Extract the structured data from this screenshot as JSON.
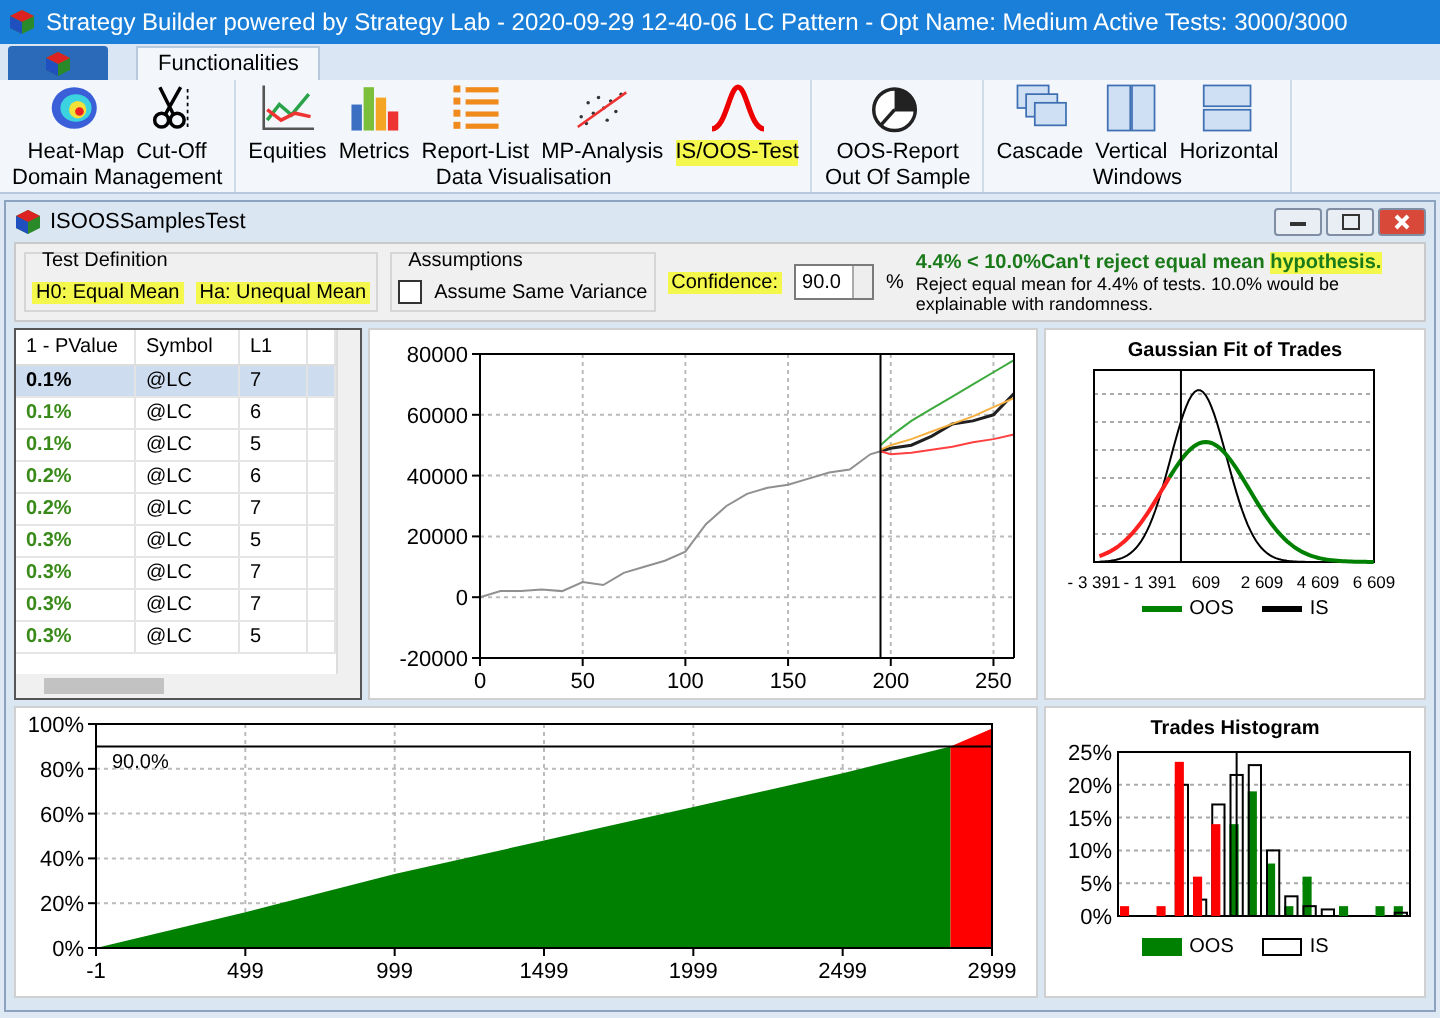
{
  "window": {
    "title": "Strategy Builder powered by Strategy Lab - 2020-09-29 12-40-06 LC Pattern - Opt Name: Medium Active Tests: 3000/3000"
  },
  "ribbon": {
    "tabs": [
      {
        "label": "Functionalities",
        "selected": true
      }
    ],
    "groups": [
      {
        "label": "Domain Management",
        "items": [
          {
            "label": "Heat-Map",
            "kind": "heatmap",
            "highlighted": false
          },
          {
            "label": "Cut-Off",
            "kind": "scissors",
            "highlighted": false
          }
        ]
      },
      {
        "label": "Data Visualisation",
        "items": [
          {
            "label": "Equities",
            "kind": "linechart",
            "highlighted": false
          },
          {
            "label": "Metrics",
            "kind": "barchart",
            "highlighted": false
          },
          {
            "label": "Report-List",
            "kind": "list",
            "highlighted": false
          },
          {
            "label": "MP-Analysis",
            "kind": "scatter",
            "highlighted": false
          },
          {
            "label": "IS/OOS-Test",
            "kind": "bell",
            "highlighted": true
          }
        ]
      },
      {
        "label": "Out Of Sample",
        "items": [
          {
            "label": "OOS-Report",
            "kind": "pie",
            "highlighted": false
          }
        ]
      },
      {
        "label": "Windows",
        "items": [
          {
            "label": "Cascade",
            "kind": "cascade",
            "highlighted": false
          },
          {
            "label": "Vertical",
            "kind": "vertical",
            "highlighted": false
          },
          {
            "label": "Horizontal",
            "kind": "horizontal",
            "highlighted": false
          }
        ]
      }
    ]
  },
  "child_window": {
    "title": "ISOOSSamplesTest"
  },
  "test_definition": {
    "title": "Test Definition",
    "h0": "H0: Equal Mean",
    "ha": "Ha: Unequal Mean",
    "highlighted": true
  },
  "assumptions": {
    "title": "Assumptions",
    "checkbox": {
      "label": "Assume Same Variance",
      "checked": false
    }
  },
  "confidence": {
    "label": "Confidence:",
    "value": "90.0",
    "unit": "%",
    "highlighted": true
  },
  "result": {
    "text": "4.4% < 10.0%Can't reject equal mean ",
    "highlight": "hypothesis.",
    "note": "Reject equal mean for 4.4% of tests. 10.0% would be explainable with randomness."
  },
  "table": {
    "columns": [
      "1 - PValue",
      "Symbol",
      "L1"
    ],
    "rows": [
      {
        "pvalue": "0.1%",
        "symbol": "@LC",
        "l1": "7",
        "selected": true
      },
      {
        "pvalue": "0.1%",
        "symbol": "@LC",
        "l1": "6",
        "selected": false
      },
      {
        "pvalue": "0.1%",
        "symbol": "@LC",
        "l1": "5",
        "selected": false
      },
      {
        "pvalue": "0.2%",
        "symbol": "@LC",
        "l1": "6",
        "selected": false
      },
      {
        "pvalue": "0.2%",
        "symbol": "@LC",
        "l1": "7",
        "selected": false
      },
      {
        "pvalue": "0.3%",
        "symbol": "@LC",
        "l1": "5",
        "selected": false
      },
      {
        "pvalue": "0.3%",
        "symbol": "@LC",
        "l1": "7",
        "selected": false
      },
      {
        "pvalue": "0.3%",
        "symbol": "@LC",
        "l1": "7",
        "selected": false
      },
      {
        "pvalue": "0.3%",
        "symbol": "@LC",
        "l1": "5",
        "selected": false
      }
    ]
  },
  "equity_chart": {
    "chart_data": {
      "type": "line",
      "x": [
        0,
        10,
        20,
        30,
        40,
        50,
        60,
        70,
        80,
        90,
        100,
        110,
        120,
        130,
        140,
        150,
        160,
        170,
        180,
        190,
        195,
        200,
        210,
        220,
        230,
        240,
        250,
        260
      ],
      "series": [
        {
          "color": "#909090",
          "values": [
            0,
            2000,
            2000,
            2500,
            2000,
            5000,
            4000,
            8000,
            10000,
            12000,
            15000,
            24000,
            30000,
            34000,
            36000,
            37000,
            39000,
            41000,
            42000,
            47000,
            48000,
            null,
            null,
            null,
            null,
            null,
            null,
            null
          ]
        },
        {
          "color": "#202020",
          "values": [
            null,
            null,
            null,
            null,
            null,
            null,
            null,
            null,
            null,
            null,
            null,
            null,
            null,
            null,
            null,
            null,
            null,
            null,
            null,
            null,
            48000,
            49000,
            50000,
            53000,
            57000,
            58000,
            60000,
            67000
          ]
        },
        {
          "color": "#3caa3c",
          "values": [
            null,
            null,
            null,
            null,
            null,
            null,
            null,
            null,
            null,
            null,
            null,
            null,
            null,
            null,
            null,
            null,
            null,
            null,
            null,
            null,
            50000,
            53000,
            58000,
            62000,
            66000,
            70000,
            74000,
            78000
          ]
        },
        {
          "color": "#f5b041",
          "values": [
            null,
            null,
            null,
            null,
            null,
            null,
            null,
            null,
            null,
            null,
            null,
            null,
            null,
            null,
            null,
            null,
            null,
            null,
            null,
            null,
            48500,
            50000,
            52000,
            54500,
            57000,
            59500,
            62500,
            65500
          ]
        },
        {
          "color": "#ff4040",
          "values": [
            null,
            null,
            null,
            null,
            null,
            null,
            null,
            null,
            null,
            null,
            null,
            null,
            null,
            null,
            null,
            null,
            null,
            null,
            null,
            null,
            48000,
            47000,
            47500,
            48500,
            49500,
            51000,
            52000,
            53500
          ]
        }
      ],
      "xlim": [
        0,
        260
      ],
      "ylim": [
        -20000,
        80000
      ],
      "xticks": [
        0,
        50,
        100,
        150,
        200,
        250
      ],
      "yticks": [
        -20000,
        0,
        20000,
        40000,
        60000,
        80000
      ],
      "grid": true,
      "ref_lines": [
        {
          "axis": "x",
          "value": 195,
          "color": "#000000"
        }
      ]
    }
  },
  "gaussian": {
    "title": "Gaussian Fit of Trades",
    "xticks": [
      "- 3 391",
      "- 1 391",
      "609",
      "2 609",
      "4 609",
      "6 609"
    ],
    "legend": [
      {
        "label": "OOS",
        "color": "#008000"
      },
      {
        "label": "IS",
        "color": "#000000"
      }
    ]
  },
  "cumulative_chart": {
    "chart_data": {
      "type": "area",
      "x": [
        -1,
        499,
        999,
        1499,
        1999,
        2499,
        2860,
        2999
      ],
      "series": [
        {
          "color": "#008000",
          "values": [
            0,
            16,
            33,
            48,
            63,
            78,
            90,
            null
          ]
        },
        {
          "color": "#ff0000",
          "values": [
            null,
            null,
            null,
            null,
            null,
            null,
            90,
            98
          ]
        }
      ],
      "xlim": [
        -1,
        2999
      ],
      "ylim": [
        0,
        100
      ],
      "xticks": [
        -1,
        499,
        999,
        1499,
        1999,
        2499,
        2999
      ],
      "yticks": [
        {
          "value": 0,
          "label": "0%"
        },
        {
          "value": 20,
          "label": "20%"
        },
        {
          "value": 40,
          "label": "40%"
        },
        {
          "value": 60,
          "label": "60%"
        },
        {
          "value": 80,
          "label": "80%"
        },
        {
          "value": 100,
          "label": "100%"
        }
      ],
      "grid": true,
      "ref_lines": [
        {
          "axis": "y",
          "value": 90,
          "label": "90.0%",
          "color": "#000000"
        }
      ]
    }
  },
  "histogram": {
    "chart_data": {
      "type": "bar",
      "title": "Trades Histogram",
      "series": [
        {
          "name": "OOS",
          "color": "#008000",
          "values": [
            0,
            0,
            0,
            0,
            0,
            0,
            14,
            19,
            8,
            1.5,
            6,
            0,
            1.5,
            0,
            1.5,
            1.5
          ]
        },
        {
          "name": "IS",
          "color": "#000000",
          "values": [
            0,
            0,
            0,
            20,
            2.5,
            17,
            21.5,
            23,
            10,
            3,
            1.5,
            1,
            0,
            0,
            0,
            0.5
          ]
        },
        {
          "color": "#ff0000",
          "values": [
            1.5,
            0,
            1.5,
            23.5,
            6,
            14,
            0,
            0,
            0,
            0,
            0,
            0,
            0,
            0,
            0,
            0
          ]
        }
      ],
      "ylim": [
        0,
        25
      ],
      "yticks": [
        {
          "value": 0,
          "label": "0%"
        },
        {
          "value": 5,
          "label": "5%"
        },
        {
          "value": 10,
          "label": "10%"
        },
        {
          "value": 15,
          "label": "15%"
        },
        {
          "value": 20,
          "label": "20%"
        },
        {
          "value": 25,
          "label": "25%"
        }
      ],
      "grid": true
    }
  }
}
